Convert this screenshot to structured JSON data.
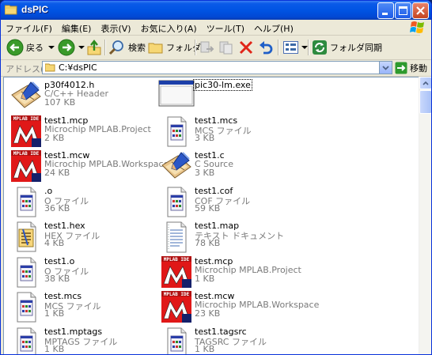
{
  "window": {
    "title": "dsPIC"
  },
  "menu": [
    "ファイル(F)",
    "編集(E)",
    "表示(V)",
    "お気に入り(A)",
    "ツール(T)",
    "ヘルプ(H)"
  ],
  "toolbar": {
    "back": "戻る",
    "search": "検索",
    "folders": "フォルダ",
    "sync": "フォルダ同期"
  },
  "address": {
    "label": "アドレス(D)",
    "value": "C:¥dsPIC",
    "go": "移動"
  },
  "files": [
    {
      "name": "p30f4012.h",
      "type": "C/C++ Header",
      "size": "107 KB",
      "icon": "visual-studio-header-icon"
    },
    {
      "name": "pic30-lm.exe",
      "type": "",
      "size": "",
      "icon": "application-window-icon"
    },
    {
      "name": "test1.mcp",
      "type": "Microchip MPLAB.Project",
      "size": "2 KB",
      "icon": "mplab-ide-icon"
    },
    {
      "name": "test1.mcs",
      "type": "MCS ファイル",
      "size": "3 KB",
      "icon": "generic-file-icon"
    },
    {
      "name": "test1.mcw",
      "type": "Microchip MPLAB.Workspace",
      "size": "24 KB",
      "icon": "mplab-ide-icon"
    },
    {
      "name": "test1.c",
      "type": "C Source",
      "size": "3 KB",
      "icon": "visual-studio-source-icon"
    },
    {
      "name": ".o",
      "type": "O ファイル",
      "size": "36 KB",
      "icon": "generic-file-icon"
    },
    {
      "name": "test1.cof",
      "type": "COF ファイル",
      "size": "59 KB",
      "icon": "generic-file-icon"
    },
    {
      "name": "test1.hex",
      "type": "HEX ファイル",
      "size": "4 KB",
      "icon": "hex-file-icon"
    },
    {
      "name": "test1.map",
      "type": "テキスト ドキュメント",
      "size": "78 KB",
      "icon": "text-document-icon"
    },
    {
      "name": "test1.o",
      "type": "O ファイル",
      "size": "38 KB",
      "icon": "generic-file-icon"
    },
    {
      "name": "test.mcp",
      "type": "Microchip MPLAB.Project",
      "size": "1 KB",
      "icon": "mplab-ide-icon"
    },
    {
      "name": "test.mcs",
      "type": "MCS ファイル",
      "size": "1 KB",
      "icon": "generic-file-icon"
    },
    {
      "name": "test.mcw",
      "type": "Microchip MPLAB.Workspace",
      "size": "23 KB",
      "icon": "mplab-ide-icon"
    },
    {
      "name": "test1.mptags",
      "type": "MPTAGS ファイル",
      "size": "1 KB",
      "icon": "generic-file-icon"
    },
    {
      "name": "test1.tagsrc",
      "type": "TAGSRC ファイル",
      "size": "1 KB",
      "icon": "generic-file-icon"
    }
  ],
  "mplab_logo_text": "MPLAB IDE"
}
